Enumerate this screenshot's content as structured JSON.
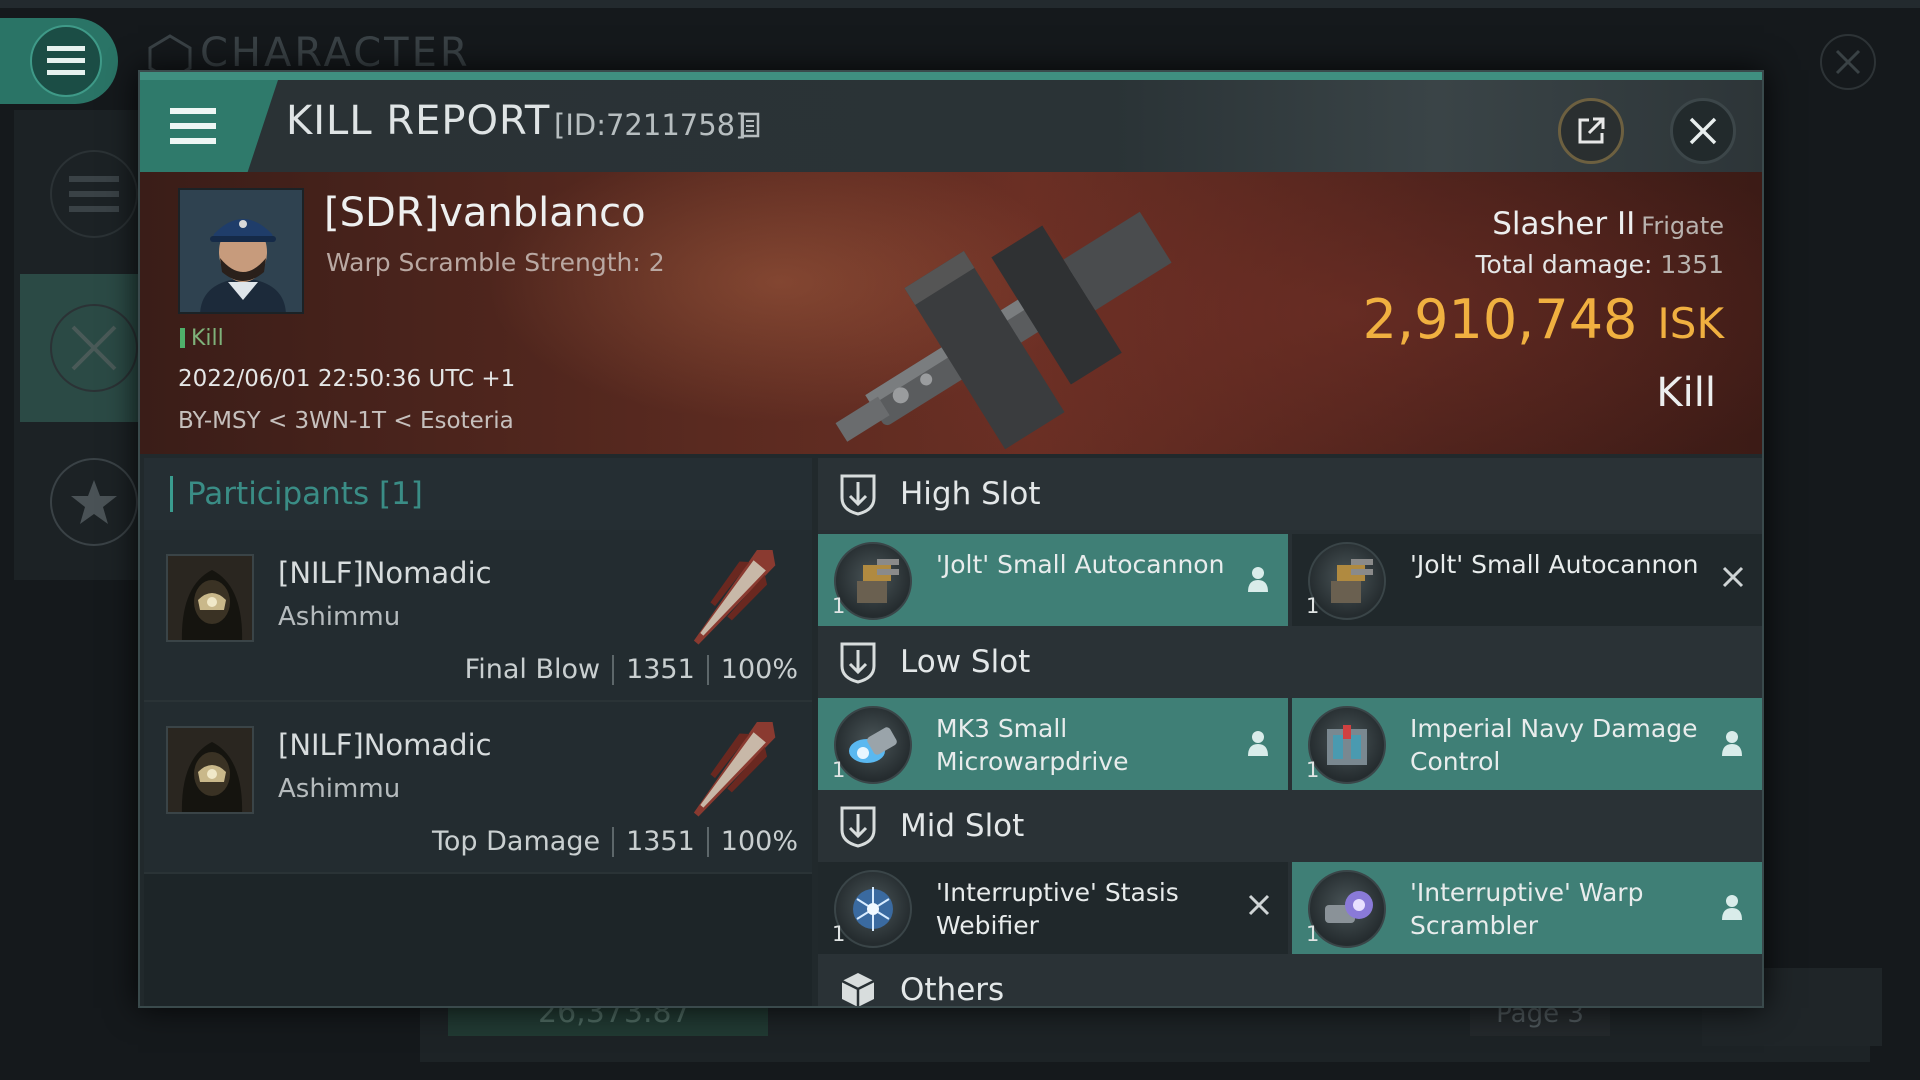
{
  "background": {
    "title": "CHARACTER",
    "bottom_value": "26,373.87",
    "page_label": "Page 3"
  },
  "window": {
    "title": "KILL REPORT",
    "id_text": "[ID:7211758]"
  },
  "victim": {
    "name": "[SDR]vanblanco",
    "subtitle": "Warp Scramble Strength: 2",
    "tag": "Kill",
    "datetime": "2022/06/01 22:50:36 UTC +1",
    "location": "BY-MSY < 3WN-1T < Esoteria",
    "ship_name": "Slasher II",
    "ship_class": "Frigate",
    "total_damage_label": "Total damage:",
    "total_damage": "1351",
    "isk_value": "2,910,748",
    "isk_unit": "ISK",
    "result_label": "Kill"
  },
  "participants": {
    "header": "Participants [1]",
    "rows": [
      {
        "name": "[NILF]Nomadic",
        "ship": "Ashimmu",
        "role": "Final Blow",
        "damage": "1351",
        "percent": "100%"
      },
      {
        "name": "[NILF]Nomadic",
        "ship": "Ashimmu",
        "role": "Top Damage",
        "damage": "1351",
        "percent": "100%"
      }
    ]
  },
  "fitting": {
    "high_slot": {
      "label": "High Slot",
      "modules": [
        {
          "qty": "1",
          "name": "'Jolt' Small Autocannon",
          "status": "fitted",
          "icon": "autocannon-icon"
        },
        {
          "qty": "1",
          "name": "'Jolt' Small Autocannon",
          "status": "destroyed",
          "icon": "autocannon-icon"
        }
      ]
    },
    "low_slot": {
      "label": "Low Slot",
      "modules": [
        {
          "qty": "1",
          "name": "MK3 Small Microwarpdrive",
          "status": "fitted",
          "icon": "microwarpdrive-icon"
        },
        {
          "qty": "1",
          "name": "Imperial Navy Damage Control",
          "status": "fitted",
          "icon": "damage-control-icon"
        }
      ]
    },
    "mid_slot": {
      "label": "Mid Slot",
      "modules": [
        {
          "qty": "1",
          "name": "'Interruptive' Stasis Webifier",
          "status": "destroyed",
          "icon": "webifier-icon"
        },
        {
          "qty": "1",
          "name": "'Interruptive' Warp Scrambler",
          "status": "fitted",
          "icon": "warp-scrambler-icon"
        }
      ]
    },
    "others": {
      "label": "Others"
    }
  },
  "colors": {
    "accent": "#2f7a6b",
    "isk": "#f0b040",
    "fitted_module": "#3f7f76"
  }
}
